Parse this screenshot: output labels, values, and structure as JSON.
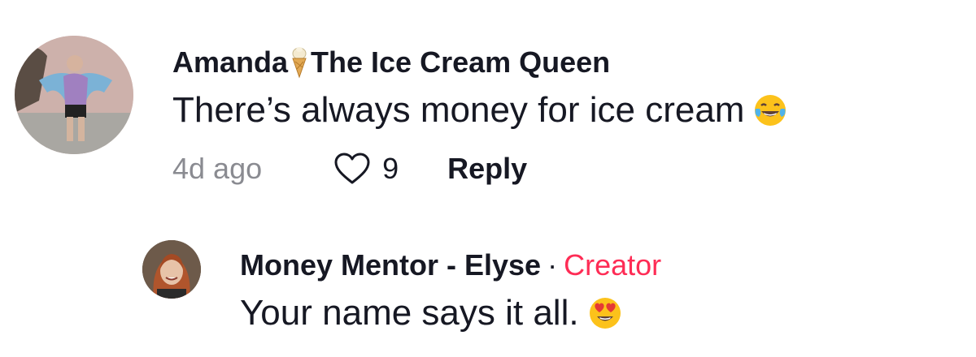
{
  "comments": [
    {
      "username_part1": "Amanda",
      "username_part2": "The Ice Cream Queen",
      "icon_in_name": "ice-cream-cone-icon",
      "text": "There’s always money for ice cream",
      "emoji": "laughing-tears-emoji",
      "time": "4d ago",
      "likes": "9",
      "reply_label": "Reply"
    }
  ],
  "reply": {
    "username": "Money Mentor - Elyse",
    "separator": "·",
    "creator_label": "Creator",
    "text": "Your name says it all.",
    "emoji": "heart-eyes-emoji"
  },
  "colors": {
    "primary_text": "#161823",
    "secondary_text": "#8a8b91",
    "creator_accent": "#fe2c55"
  }
}
